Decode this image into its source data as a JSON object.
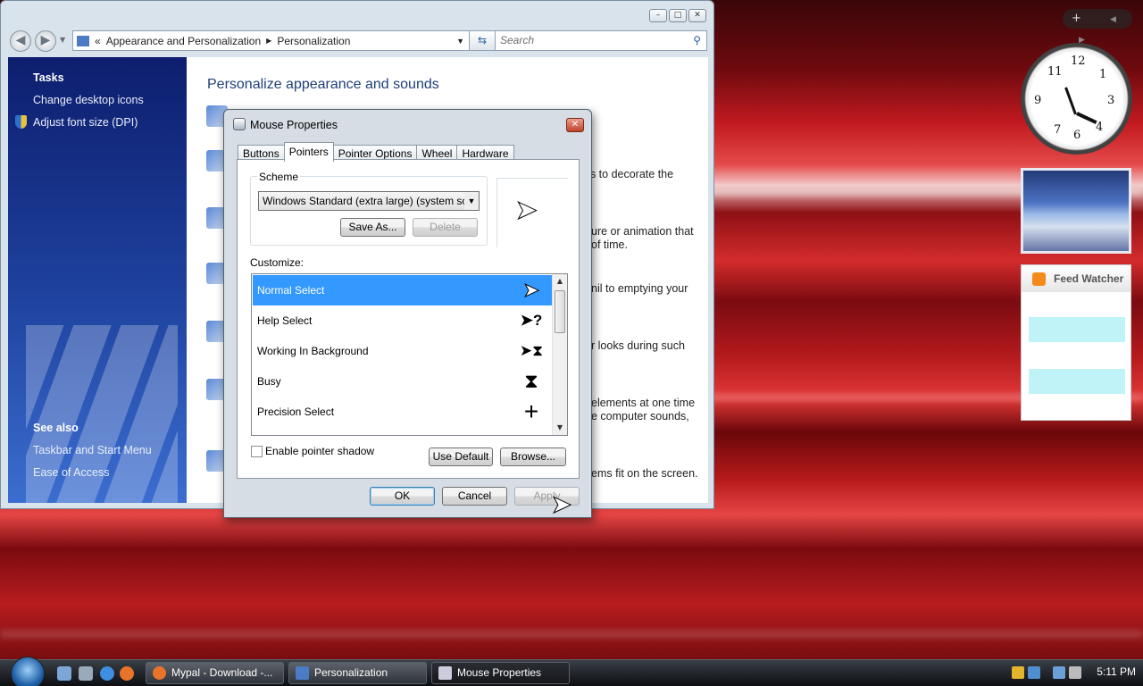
{
  "explorer": {
    "address": {
      "prefix": "«",
      "crumbs": [
        "Appearance and Personalization",
        "Personalization"
      ]
    },
    "search_placeholder": "Search",
    "tasks": {
      "header": "Tasks",
      "items": [
        "Change desktop icons",
        "Adjust font size (DPI)"
      ]
    },
    "see_also": {
      "header": "See also",
      "items": [
        "Taskbar and Start Menu",
        "Ease of Access"
      ]
    },
    "main_title": "Personalize appearance and sounds",
    "fragments": [
      "es to decorate the",
      "ure or animation that",
      "of time.",
      "nil to emptying your",
      "r looks during such",
      "elements at one time",
      "e computer sounds,",
      "ems fit on the screen."
    ]
  },
  "dialog": {
    "title": "Mouse Properties",
    "tabs": [
      "Buttons",
      "Pointers",
      "Pointer Options",
      "Wheel",
      "Hardware"
    ],
    "active_tab": "Pointers",
    "scheme": {
      "label": "Scheme",
      "value": "Windows Standard (extra large) (system scheme)",
      "save_as": "Save As...",
      "delete": "Delete"
    },
    "customize_label": "Customize:",
    "pointers": [
      {
        "name": "Normal Select",
        "icon": "arrow-cursor-icon",
        "glyph": "➤"
      },
      {
        "name": "Help Select",
        "icon": "help-cursor-icon",
        "glyph": "➤?"
      },
      {
        "name": "Working In Background",
        "icon": "working-cursor-icon",
        "glyph": "➤⧗"
      },
      {
        "name": "Busy",
        "icon": "hourglass-icon",
        "glyph": "⧗"
      },
      {
        "name": "Precision Select",
        "icon": "crosshair-icon",
        "glyph": "+"
      }
    ],
    "enable_shadow": "Enable pointer shadow",
    "use_default": "Use Default",
    "browse": "Browse...",
    "ok": "OK",
    "cancel": "Cancel",
    "apply": "Apply"
  },
  "gadgets": {
    "feed_title": "Feed Watcher"
  },
  "taskbar": {
    "tasks": [
      {
        "label": "Mypal - Download -...",
        "icon": "mypal-icon"
      },
      {
        "label": "Personalization",
        "icon": "control-panel-icon"
      },
      {
        "label": "Mouse Properties",
        "icon": "mouse-icon"
      }
    ],
    "time": "5:11 PM"
  },
  "colors": {
    "selection": "#3399ff",
    "title_blue": "#1e3f7a"
  }
}
